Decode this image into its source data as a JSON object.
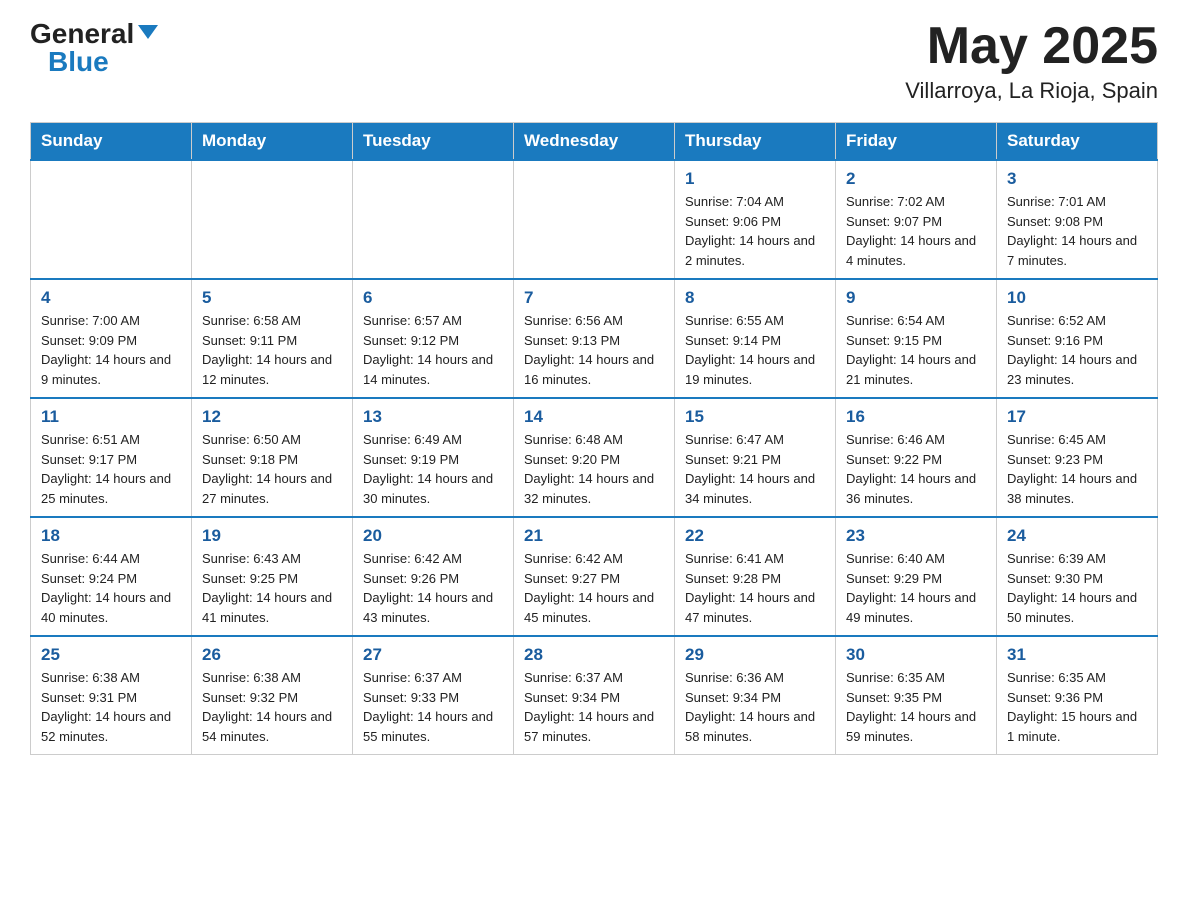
{
  "header": {
    "logo_general": "General",
    "logo_blue": "Blue",
    "month_title": "May 2025",
    "location": "Villarroya, La Rioja, Spain"
  },
  "days_of_week": [
    "Sunday",
    "Monday",
    "Tuesday",
    "Wednesday",
    "Thursday",
    "Friday",
    "Saturday"
  ],
  "weeks": [
    [
      {
        "day": "",
        "info": ""
      },
      {
        "day": "",
        "info": ""
      },
      {
        "day": "",
        "info": ""
      },
      {
        "day": "",
        "info": ""
      },
      {
        "day": "1",
        "info": "Sunrise: 7:04 AM\nSunset: 9:06 PM\nDaylight: 14 hours and 2 minutes."
      },
      {
        "day": "2",
        "info": "Sunrise: 7:02 AM\nSunset: 9:07 PM\nDaylight: 14 hours and 4 minutes."
      },
      {
        "day": "3",
        "info": "Sunrise: 7:01 AM\nSunset: 9:08 PM\nDaylight: 14 hours and 7 minutes."
      }
    ],
    [
      {
        "day": "4",
        "info": "Sunrise: 7:00 AM\nSunset: 9:09 PM\nDaylight: 14 hours and 9 minutes."
      },
      {
        "day": "5",
        "info": "Sunrise: 6:58 AM\nSunset: 9:11 PM\nDaylight: 14 hours and 12 minutes."
      },
      {
        "day": "6",
        "info": "Sunrise: 6:57 AM\nSunset: 9:12 PM\nDaylight: 14 hours and 14 minutes."
      },
      {
        "day": "7",
        "info": "Sunrise: 6:56 AM\nSunset: 9:13 PM\nDaylight: 14 hours and 16 minutes."
      },
      {
        "day": "8",
        "info": "Sunrise: 6:55 AM\nSunset: 9:14 PM\nDaylight: 14 hours and 19 minutes."
      },
      {
        "day": "9",
        "info": "Sunrise: 6:54 AM\nSunset: 9:15 PM\nDaylight: 14 hours and 21 minutes."
      },
      {
        "day": "10",
        "info": "Sunrise: 6:52 AM\nSunset: 9:16 PM\nDaylight: 14 hours and 23 minutes."
      }
    ],
    [
      {
        "day": "11",
        "info": "Sunrise: 6:51 AM\nSunset: 9:17 PM\nDaylight: 14 hours and 25 minutes."
      },
      {
        "day": "12",
        "info": "Sunrise: 6:50 AM\nSunset: 9:18 PM\nDaylight: 14 hours and 27 minutes."
      },
      {
        "day": "13",
        "info": "Sunrise: 6:49 AM\nSunset: 9:19 PM\nDaylight: 14 hours and 30 minutes."
      },
      {
        "day": "14",
        "info": "Sunrise: 6:48 AM\nSunset: 9:20 PM\nDaylight: 14 hours and 32 minutes."
      },
      {
        "day": "15",
        "info": "Sunrise: 6:47 AM\nSunset: 9:21 PM\nDaylight: 14 hours and 34 minutes."
      },
      {
        "day": "16",
        "info": "Sunrise: 6:46 AM\nSunset: 9:22 PM\nDaylight: 14 hours and 36 minutes."
      },
      {
        "day": "17",
        "info": "Sunrise: 6:45 AM\nSunset: 9:23 PM\nDaylight: 14 hours and 38 minutes."
      }
    ],
    [
      {
        "day": "18",
        "info": "Sunrise: 6:44 AM\nSunset: 9:24 PM\nDaylight: 14 hours and 40 minutes."
      },
      {
        "day": "19",
        "info": "Sunrise: 6:43 AM\nSunset: 9:25 PM\nDaylight: 14 hours and 41 minutes."
      },
      {
        "day": "20",
        "info": "Sunrise: 6:42 AM\nSunset: 9:26 PM\nDaylight: 14 hours and 43 minutes."
      },
      {
        "day": "21",
        "info": "Sunrise: 6:42 AM\nSunset: 9:27 PM\nDaylight: 14 hours and 45 minutes."
      },
      {
        "day": "22",
        "info": "Sunrise: 6:41 AM\nSunset: 9:28 PM\nDaylight: 14 hours and 47 minutes."
      },
      {
        "day": "23",
        "info": "Sunrise: 6:40 AM\nSunset: 9:29 PM\nDaylight: 14 hours and 49 minutes."
      },
      {
        "day": "24",
        "info": "Sunrise: 6:39 AM\nSunset: 9:30 PM\nDaylight: 14 hours and 50 minutes."
      }
    ],
    [
      {
        "day": "25",
        "info": "Sunrise: 6:38 AM\nSunset: 9:31 PM\nDaylight: 14 hours and 52 minutes."
      },
      {
        "day": "26",
        "info": "Sunrise: 6:38 AM\nSunset: 9:32 PM\nDaylight: 14 hours and 54 minutes."
      },
      {
        "day": "27",
        "info": "Sunrise: 6:37 AM\nSunset: 9:33 PM\nDaylight: 14 hours and 55 minutes."
      },
      {
        "day": "28",
        "info": "Sunrise: 6:37 AM\nSunset: 9:34 PM\nDaylight: 14 hours and 57 minutes."
      },
      {
        "day": "29",
        "info": "Sunrise: 6:36 AM\nSunset: 9:34 PM\nDaylight: 14 hours and 58 minutes."
      },
      {
        "day": "30",
        "info": "Sunrise: 6:35 AM\nSunset: 9:35 PM\nDaylight: 14 hours and 59 minutes."
      },
      {
        "day": "31",
        "info": "Sunrise: 6:35 AM\nSunset: 9:36 PM\nDaylight: 15 hours and 1 minute."
      }
    ]
  ]
}
